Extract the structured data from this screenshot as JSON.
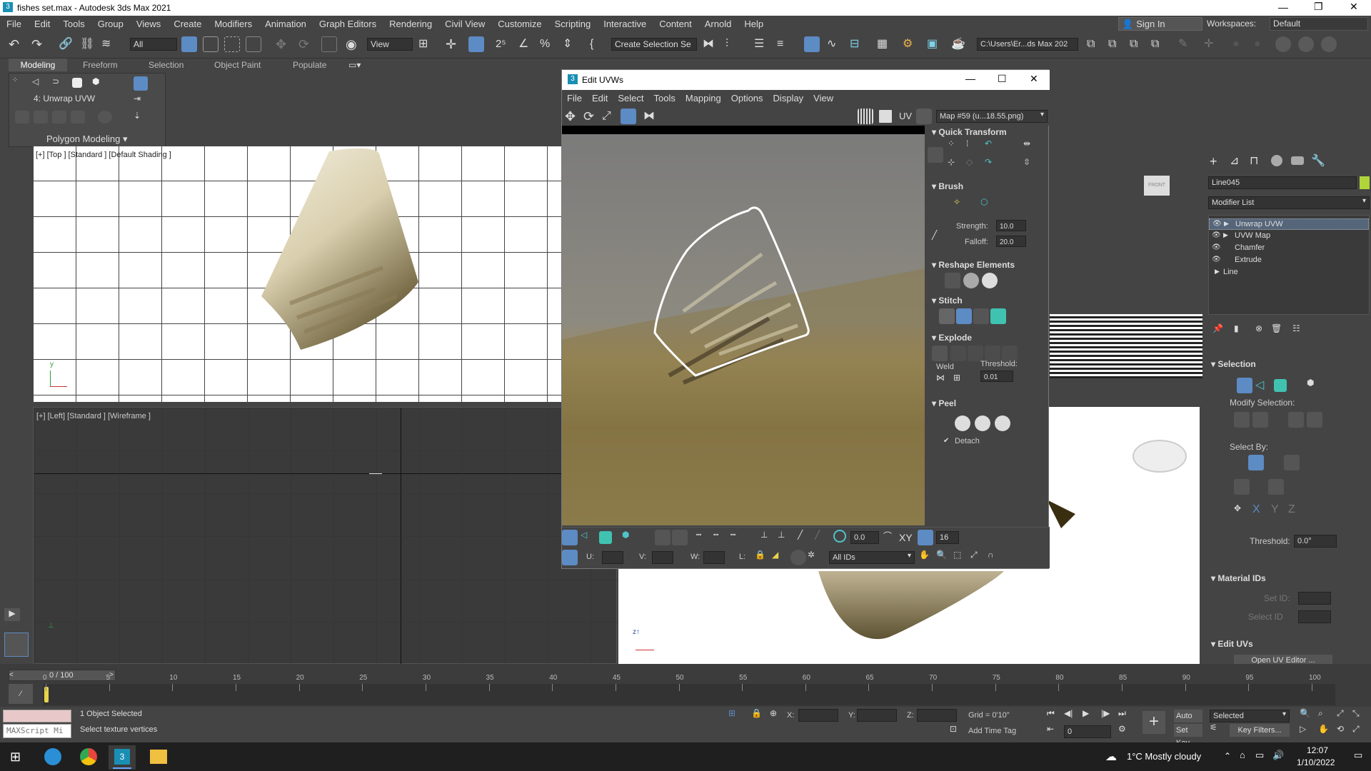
{
  "app": {
    "title": "fishes set.max - Autodesk 3ds Max 2021"
  },
  "menu": [
    "File",
    "Edit",
    "Tools",
    "Group",
    "Views",
    "Create",
    "Modifiers",
    "Animation",
    "Graph Editors",
    "Rendering",
    "Civil View",
    "Customize",
    "Scripting",
    "Interactive",
    "Content",
    "Arnold",
    "Help"
  ],
  "signin": "Sign In",
  "workspaces_label": "Workspaces:",
  "workspaces_value": "Default",
  "toolbar": {
    "filter": "All",
    "refcoord": "View",
    "selection_set": "Create Selection Se",
    "path": "C:\\Users\\Er...ds Max 202"
  },
  "ribbon": {
    "tabs": [
      "Modeling",
      "Freeform",
      "Selection",
      "Object Paint",
      "Populate"
    ],
    "modifier_label": "4: Unwrap UVW",
    "polygon_modeling": "Polygon Modeling"
  },
  "viewports": {
    "top": "[+] [Top ] [Standard ] [Default Shading ]",
    "left": "[+] [Left] [Standard ] [Wireframe ]"
  },
  "uvw": {
    "title": "Edit UVWs",
    "menu": [
      "File",
      "Edit",
      "Select",
      "Tools",
      "Mapping",
      "Options",
      "Display",
      "View"
    ],
    "uv_label": "UV",
    "map": "Map #59 (u...18.55.png)",
    "quick_transform": "Quick Transform",
    "brush": "Brush",
    "strength_label": "Strength:",
    "strength": "10.0",
    "falloff_label": "Falloff:",
    "falloff": "20.0",
    "reshape": "Reshape Elements",
    "stitch": "Stitch",
    "explode": "Explode",
    "weld": "Weld",
    "threshold_label": "Threshold:",
    "threshold": "0.01",
    "peel": "Peel",
    "detach": "Detach",
    "spin_value": "0.0",
    "xy": "XY",
    "grid_value": "16",
    "u": "U:",
    "v": "V:",
    "w": "W:",
    "l": "L:",
    "ids": "All IDs"
  },
  "command_panel": {
    "object_name": "Line045",
    "modifier_list": "Modifier List",
    "stack": [
      "Unwrap UVW",
      "UVW Map",
      "Chamfer",
      "Extrude",
      "Line"
    ],
    "selection": "Selection",
    "modify_selection": "Modify Selection:",
    "select_by": "Select By:",
    "threshold_label": "Threshold:",
    "threshold": "0.0°",
    "material_ids": "Material IDs",
    "set_id": "Set ID:",
    "select_id": "Select ID",
    "edit_uvs": "Edit UVs",
    "open_uv_editor": "Open UV Editor ..."
  },
  "timeline": {
    "frame": "0 / 100",
    "ticks": [
      "0",
      "5",
      "10",
      "15",
      "20",
      "25",
      "30",
      "35",
      "40",
      "45",
      "50",
      "55",
      "60",
      "65",
      "70",
      "75",
      "80",
      "85",
      "90",
      "95",
      "100"
    ]
  },
  "status": {
    "maxscript": "MAXScript Mi",
    "objects": "1 Object Selected",
    "prompt": "Select texture vertices",
    "x": "X:",
    "y": "Y:",
    "z": "Z:",
    "grid": "Grid = 0'10\"",
    "time_tag": "Add Time Tag",
    "autokey": "Auto K...",
    "setkey": "Set Key",
    "selected": "Selected",
    "key_filters": "Key Filters...",
    "frame": "0"
  },
  "taskbar": {
    "weather": "1°C  Mostly cloudy",
    "time": "12:07",
    "date": "1/10/2022"
  }
}
